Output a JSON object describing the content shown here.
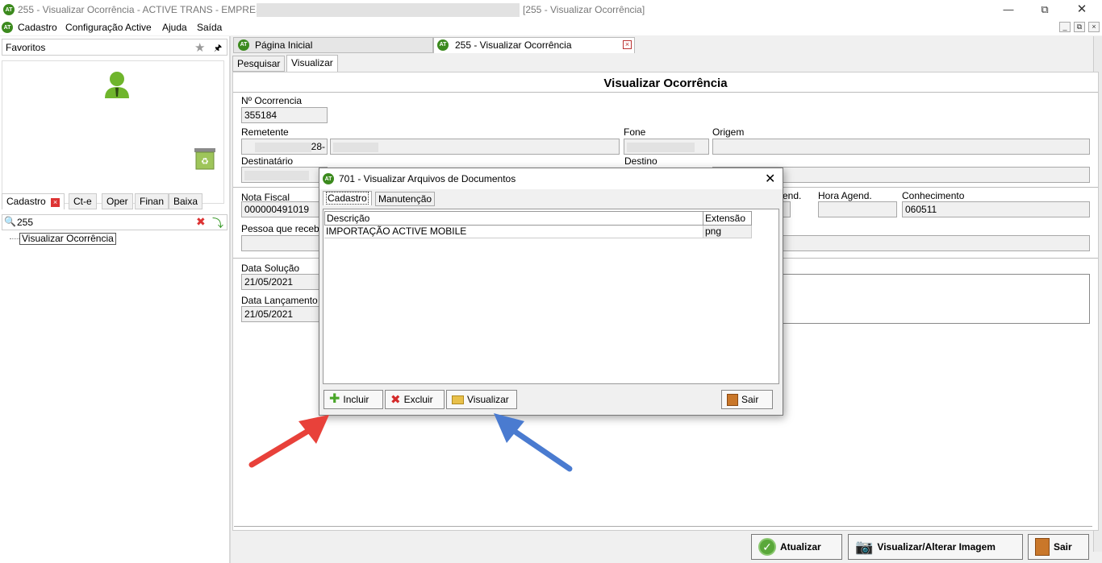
{
  "window": {
    "title_prefix": "255 - Visualizar Ocorrência - ACTIVE TRANS - EMPRESA: ",
    "title_suffix": "[255 - Visualizar Ocorrência]"
  },
  "menu": [
    "Cadastro",
    "Configuração Active",
    "Ajuda",
    "Saída"
  ],
  "left": {
    "favorites_label": "Favoritos",
    "tabs": [
      "Cadastro",
      "Ct-e",
      "Oper",
      "Finan",
      "Baixa"
    ],
    "search_value": "255",
    "tree_item": "Visualizar Ocorrência"
  },
  "doc_tabs": [
    "Página Inicial",
    "255 - Visualizar Ocorrência"
  ],
  "sub_tabs": [
    "Pesquisar",
    "Visualizar"
  ],
  "form": {
    "heading": "Visualizar Ocorrência",
    "n_ocorrencia_label": "Nº Ocorrencia",
    "n_ocorrencia": "355184",
    "remetente_label": "Remetente",
    "remetente_suffix": "28-",
    "fone_label": "Fone",
    "origem_label": "Origem",
    "destinatario_label": "Destinatário",
    "destino_label": "Destino",
    "nota_fiscal_label": "Nota Fiscal",
    "nota_fiscal": "000000491019",
    "agend_label_partial": "end.",
    "hora_agend_label": "Hora Agend.",
    "conhecimento_label": "Conhecimento",
    "conhecimento": "060511",
    "pessoa_label": "Pessoa que receb",
    "data_solucao_label": "Data Solução",
    "data_solucao": "21/05/2021",
    "data_lancamento_label": "Data Lançamento",
    "data_lancamento": "21/05/2021"
  },
  "bottom_buttons": {
    "atualizar": "Atualizar",
    "visualizar_imagem": "Visualizar/Alterar Imagem",
    "sair": "Sair"
  },
  "dialog": {
    "title": "701 - Visualizar Arquivos de Documentos",
    "tabs": [
      "Cadastro",
      "Manutenção"
    ],
    "columns": [
      "Descrição",
      "Extensão"
    ],
    "rows": [
      {
        "descricao": "IMPORTAÇÃO ACTIVE MOBILE",
        "extensao": "png"
      }
    ],
    "buttons": {
      "incluir": "Incluir",
      "excluir": "Excluir",
      "visualizar": "Visualizar",
      "sair": "Sair"
    }
  },
  "colors": {
    "red_arrow": "#e8413a",
    "blue_arrow": "#4a7bd0",
    "logo_green": "#3c8a1e"
  }
}
